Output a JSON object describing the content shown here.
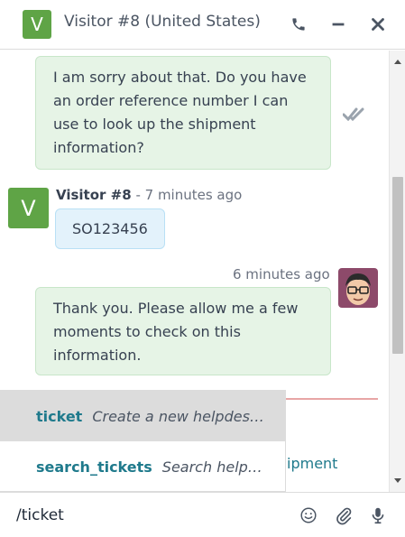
{
  "header": {
    "avatar_letter": "V",
    "title": "Visitor #8 (United States)",
    "icons": [
      "phone-icon",
      "minimize-icon",
      "close-icon"
    ]
  },
  "thread": {
    "messages": [
      {
        "from": "agent",
        "text": "I am sorry about that. Do you have an order reference number I can use to look up the shipment information?",
        "status_icon": "seen-checkmarks-icon"
      },
      {
        "from": "visitor",
        "avatar_letter": "V",
        "author": "Visitor #8",
        "time": "- 7 minutes ago",
        "text": "SO123456"
      },
      {
        "from": "agent",
        "time": "6 minutes ago",
        "text": "Thank you. Please allow me a few moments to check on this information."
      }
    ],
    "partially_hidden_text": "ipment"
  },
  "suggestions": [
    {
      "command": "ticket",
      "description": "Create a new helpdes…",
      "active": true
    },
    {
      "command": "search_tickets",
      "description": "Search help…",
      "active": false
    }
  ],
  "composer": {
    "value": "/ticket",
    "icons": [
      "emoji-icon",
      "paperclip-icon",
      "microphone-icon"
    ]
  },
  "colors": {
    "visitor_avatar": "#5fa446",
    "agent_bubble": "#e6f4e6",
    "visitor_bubble": "#e3f2fb",
    "command": "#1f7a8c"
  }
}
